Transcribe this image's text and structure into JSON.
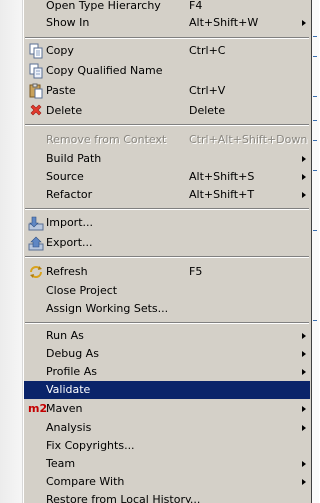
{
  "menu": {
    "items": [
      {
        "label": "Open Type Hierarchy",
        "shortcut": "F4"
      },
      {
        "label": "Show In",
        "shortcut": "Alt+Shift+W"
      },
      {
        "label": "Copy",
        "shortcut": "Ctrl+C",
        "icon": "copy-icon"
      },
      {
        "label": "Copy Qualified Name",
        "shortcut": "",
        "icon": "copy-qualified-name-icon"
      },
      {
        "label": "Paste",
        "shortcut": "Ctrl+V",
        "icon": "paste-icon"
      },
      {
        "label": "Delete",
        "shortcut": "Delete",
        "icon": "delete-icon"
      },
      {
        "label": "Remove from Context",
        "shortcut": "Ctrl+Alt+Shift+Down",
        "disabled": true
      },
      {
        "label": "Build Path",
        "shortcut": ""
      },
      {
        "label": "Source",
        "shortcut": "Alt+Shift+S"
      },
      {
        "label": "Refactor",
        "shortcut": "Alt+Shift+T"
      },
      {
        "label": "Import...",
        "shortcut": "",
        "icon": "import-icon"
      },
      {
        "label": "Export...",
        "shortcut": "",
        "icon": "export-icon"
      },
      {
        "label": "Refresh",
        "shortcut": "F5",
        "icon": "refresh-icon"
      },
      {
        "label": "Close Project",
        "shortcut": ""
      },
      {
        "label": "Assign Working Sets...",
        "shortcut": ""
      },
      {
        "label": "Run As",
        "shortcut": ""
      },
      {
        "label": "Debug As",
        "shortcut": ""
      },
      {
        "label": "Profile As",
        "shortcut": ""
      },
      {
        "label": "Validate",
        "shortcut": "",
        "selected": true
      },
      {
        "label": "Maven",
        "shortcut": "",
        "icon_text": "m2"
      },
      {
        "label": "Analysis",
        "shortcut": ""
      },
      {
        "label": "Fix Copyrights...",
        "shortcut": ""
      },
      {
        "label": "Team",
        "shortcut": ""
      },
      {
        "label": "Compare With",
        "shortcut": ""
      },
      {
        "label": "Restore from Local History...",
        "shortcut": ""
      }
    ]
  },
  "colors": {
    "menu_background": "#d4d0c8",
    "selection": "#0a246a",
    "disabled_text": "#8a8780",
    "maven_red": "#c40000"
  }
}
